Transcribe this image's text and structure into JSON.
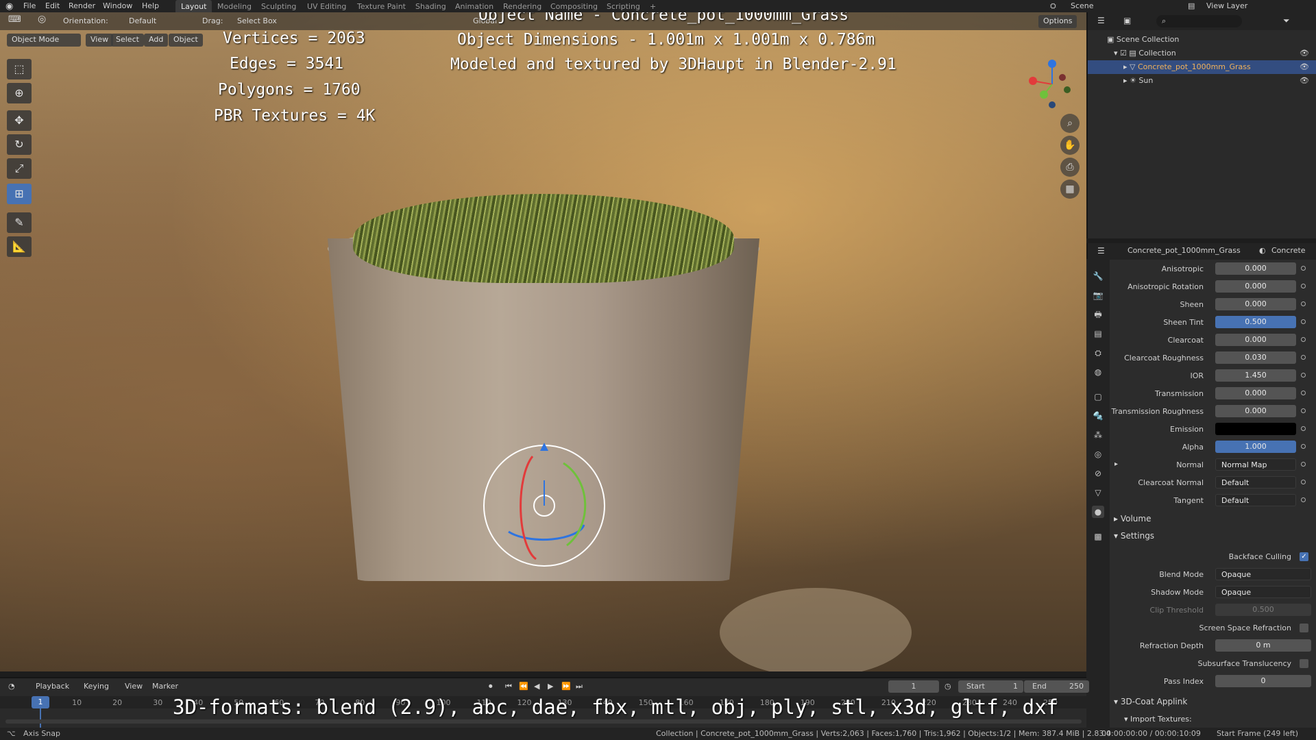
{
  "topbar": {
    "menus": [
      "File",
      "Edit",
      "Render",
      "Window",
      "Help"
    ],
    "workspaces": [
      "Layout",
      "Modeling",
      "Sculpting",
      "UV Editing",
      "Texture Paint",
      "Shading",
      "Animation",
      "Rendering",
      "Compositing",
      "Scripting"
    ],
    "add_tab": "+",
    "scene": "Scene",
    "view_layer": "View Layer"
  },
  "viewport_header": {
    "orientation_label": "Orientation:",
    "orientation_value": "Default",
    "drag_label": "Drag:",
    "drag_value": "Select Box",
    "transform": "Global",
    "options": "Options",
    "mode": "Object Mode",
    "view": "View",
    "select": "Select",
    "add": "Add",
    "object": "Object"
  },
  "overlay": {
    "object_name": "Object Name - Concrete_pot_1000mm_Grass",
    "vertices": "Vertices = 2063",
    "edges": "Edges = 3541",
    "polygons": "Polygons = 1760",
    "textures": "PBR Textures = 4K",
    "dimensions": "Object Dimensions -  1.001m x 1.001m x 0.786m",
    "modeled_by": "Modeled and textured by 3DHaupt in Blender-2.91",
    "formats": "3D-formats: blend (2.9), abc, dae, fbx, mtl, obj, ply, stl, x3d, gltf, dxf"
  },
  "outliner": {
    "root": "Scene Collection",
    "collection": "Collection",
    "items": [
      {
        "name": "Concrete_pot_1000mm_Grass",
        "selected": true
      },
      {
        "name": "Sun",
        "selected": false
      }
    ]
  },
  "properties": {
    "object_name": "Concrete_pot_1000mm_Grass",
    "material_name": "Concrete",
    "rows": [
      {
        "label": "Anisotropic",
        "value": "0.000",
        "style": "plain"
      },
      {
        "label": "Anisotropic Rotation",
        "value": "0.000",
        "style": "plain"
      },
      {
        "label": "Sheen",
        "value": "0.000",
        "style": "plain"
      },
      {
        "label": "Sheen Tint",
        "value": "0.500",
        "style": "blue"
      },
      {
        "label": "Clearcoat",
        "value": "0.000",
        "style": "plain"
      },
      {
        "label": "Clearcoat Roughness",
        "value": "0.030",
        "style": "plain"
      },
      {
        "label": "IOR",
        "value": "1.450",
        "style": "plain"
      },
      {
        "label": "Transmission",
        "value": "0.000",
        "style": "plain"
      },
      {
        "label": "Transmission Roughness",
        "value": "0.000",
        "style": "plain"
      },
      {
        "label": "Emission",
        "value": "",
        "style": "black"
      },
      {
        "label": "Alpha",
        "value": "1.000",
        "style": "blue"
      },
      {
        "label": "Normal",
        "value": "Normal Map",
        "style": "dropdown"
      },
      {
        "label": "Clearcoat Normal",
        "value": "Default",
        "style": "dropdown"
      },
      {
        "label": "Tangent",
        "value": "Default",
        "style": "dropdown"
      }
    ],
    "volume_section": "Volume",
    "settings_section": "Settings",
    "backface_culling": "Backface Culling",
    "blend_mode_label": "Blend Mode",
    "blend_mode": "Opaque",
    "shadow_mode_label": "Shadow Mode",
    "shadow_mode": "Opaque",
    "clip_threshold_label": "Clip Threshold",
    "clip_threshold": "0.500",
    "ssr_label": "Screen Space Refraction",
    "refraction_depth_label": "Refraction Depth",
    "refraction_depth": "0 m",
    "subsurface_label": "Subsurface Translucency",
    "pass_index_label": "Pass Index",
    "pass_index": "0",
    "applink_section": "3D-Coat Applink",
    "import_textures": "Import Textures:"
  },
  "timeline": {
    "playback": "Playback",
    "keying": "Keying",
    "view": "View",
    "marker": "Marker",
    "current_frame": "1",
    "start_label": "Start",
    "start": "1",
    "end_label": "End",
    "end": "250",
    "frames": [
      "1",
      "10",
      "20",
      "30",
      "40",
      "50",
      "60",
      "70",
      "80",
      "90",
      "100",
      "110",
      "120",
      "130",
      "140",
      "150",
      "160",
      "170",
      "180",
      "190",
      "200",
      "210",
      "220",
      "230",
      "240",
      "250"
    ]
  },
  "status": {
    "left": "Axis Snap",
    "info": "Collection | Concrete_pot_1000mm_Grass | Verts:2,063 | Faces:1,760 | Tris:1,962 | Objects:1/2 | Mem: 387.4 MiB | 2.83.4",
    "time": "00:00:00:00 / 00:00:10:09",
    "start_frame": "Start Frame (249 left)"
  },
  "colors": {
    "accent": "#4772b3",
    "selected_row": "#334d80"
  }
}
